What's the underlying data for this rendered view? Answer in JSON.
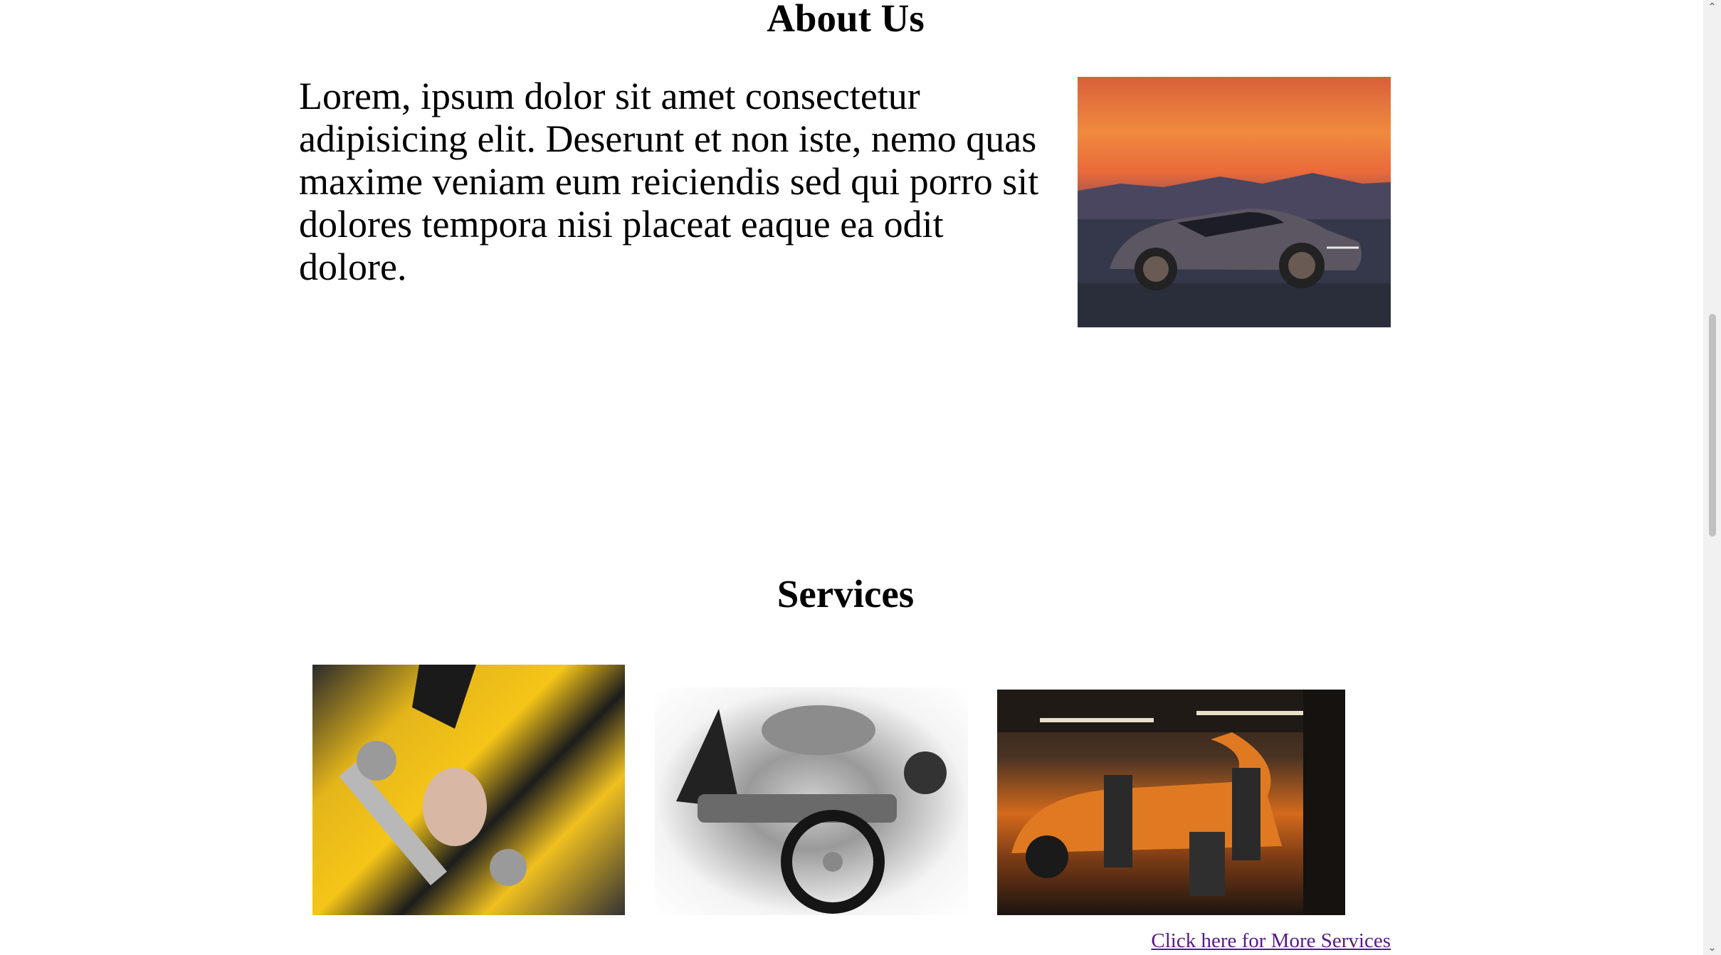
{
  "about": {
    "title": "About Us",
    "text": "Lorem, ipsum dolor sit amet consectetur adipisicing elit. Deserunt et non iste, nemo quas maxime veniam eum reiciendis sed qui porro sit dolores tempora nisi placeat eaque ea odit dolore.",
    "image": "sports-car-sunset-image"
  },
  "services": {
    "title": "Services",
    "images": [
      "mechanic-wrench-image",
      "car-parts-image",
      "garage-mechanics-image"
    ],
    "more_link": "Click here for More Services",
    "link_color": "#551a8b"
  },
  "scrollbar": {
    "up_icon": "chevron-up-icon",
    "down_icon": "chevron-down-icon"
  }
}
